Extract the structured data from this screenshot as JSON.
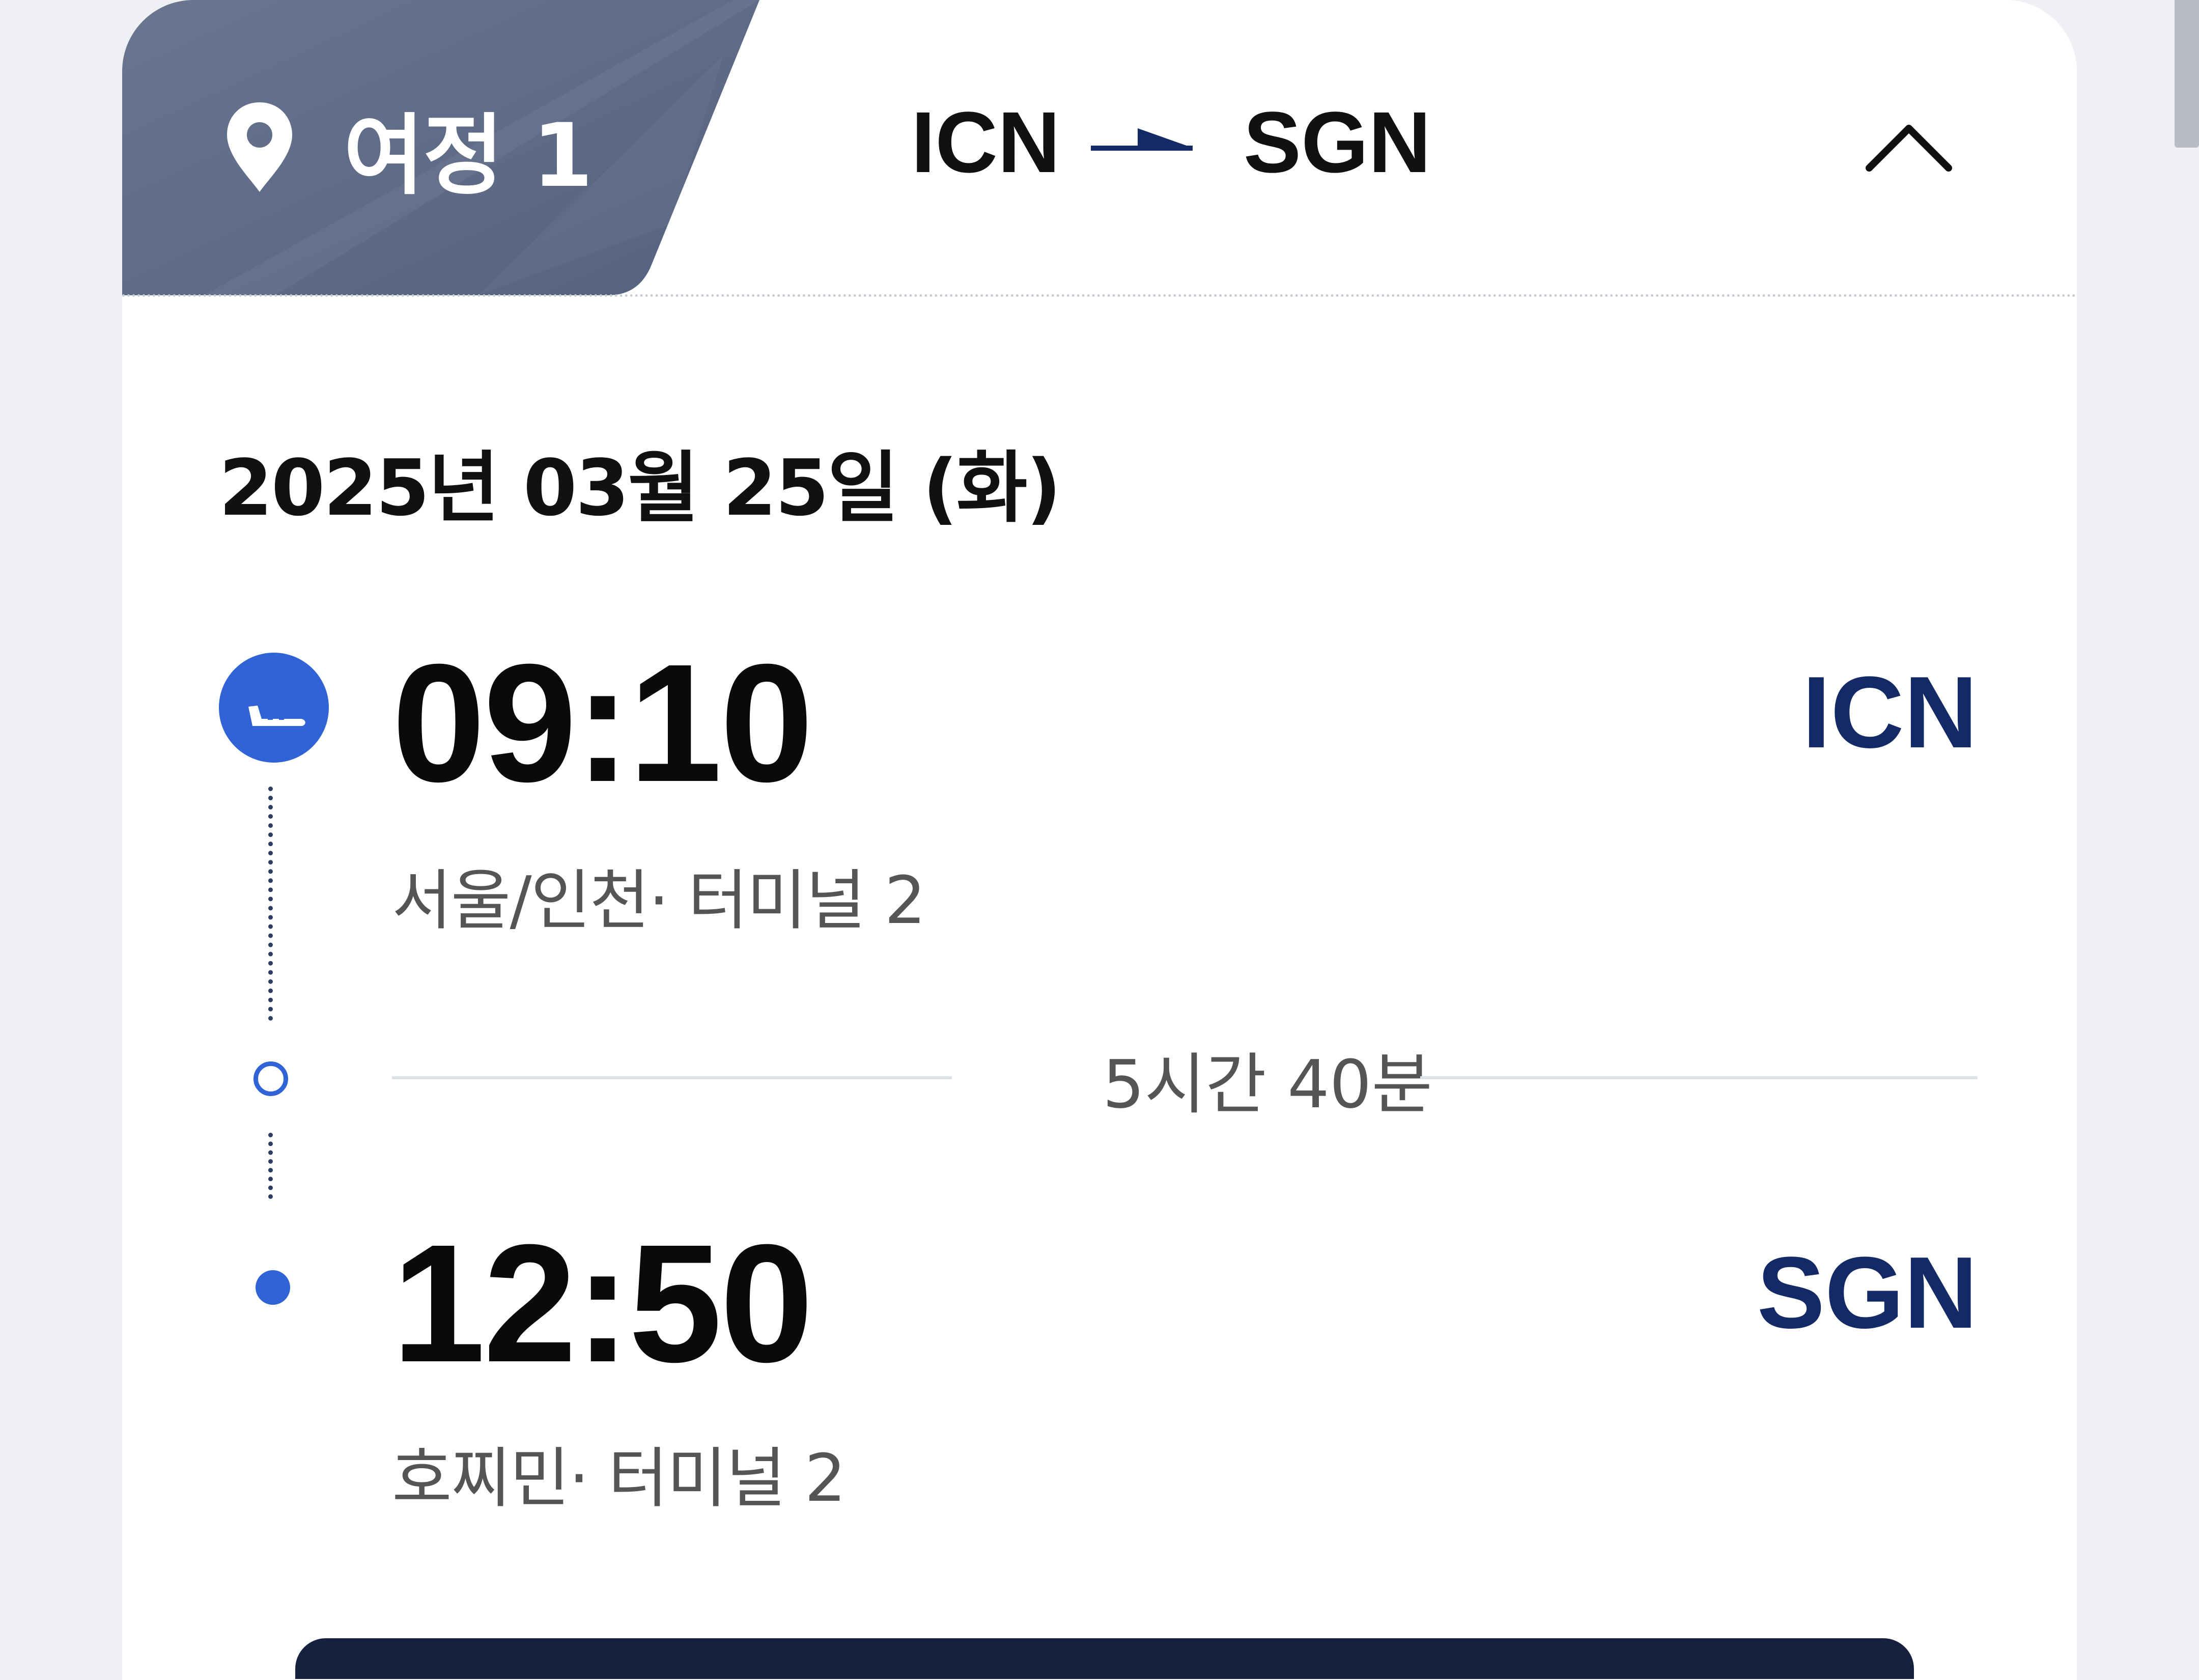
{
  "header": {
    "segment_label": "여정 1",
    "origin_code": "ICN",
    "destination_code": "SGN",
    "collapse_icon": "chevron-up-icon",
    "location_icon": "map-pin-icon",
    "route_icon": "flight-arrow-icon"
  },
  "flight": {
    "date": "2025년 03월 25일 (화)",
    "departure": {
      "time": "09:10",
      "code": "ICN",
      "place": "서울/인천· 터미널   2",
      "icon": "takeoff-icon"
    },
    "duration": "5시간 40분",
    "arrival": {
      "time": "12:50",
      "code": "SGN",
      "place": "호찌민· 터미널   2"
    }
  },
  "colors": {
    "tag_background": "#5f6d8a",
    "accent_blue": "#2f63d6",
    "code_navy": "#142a66",
    "bottom_bar": "#16213e"
  }
}
